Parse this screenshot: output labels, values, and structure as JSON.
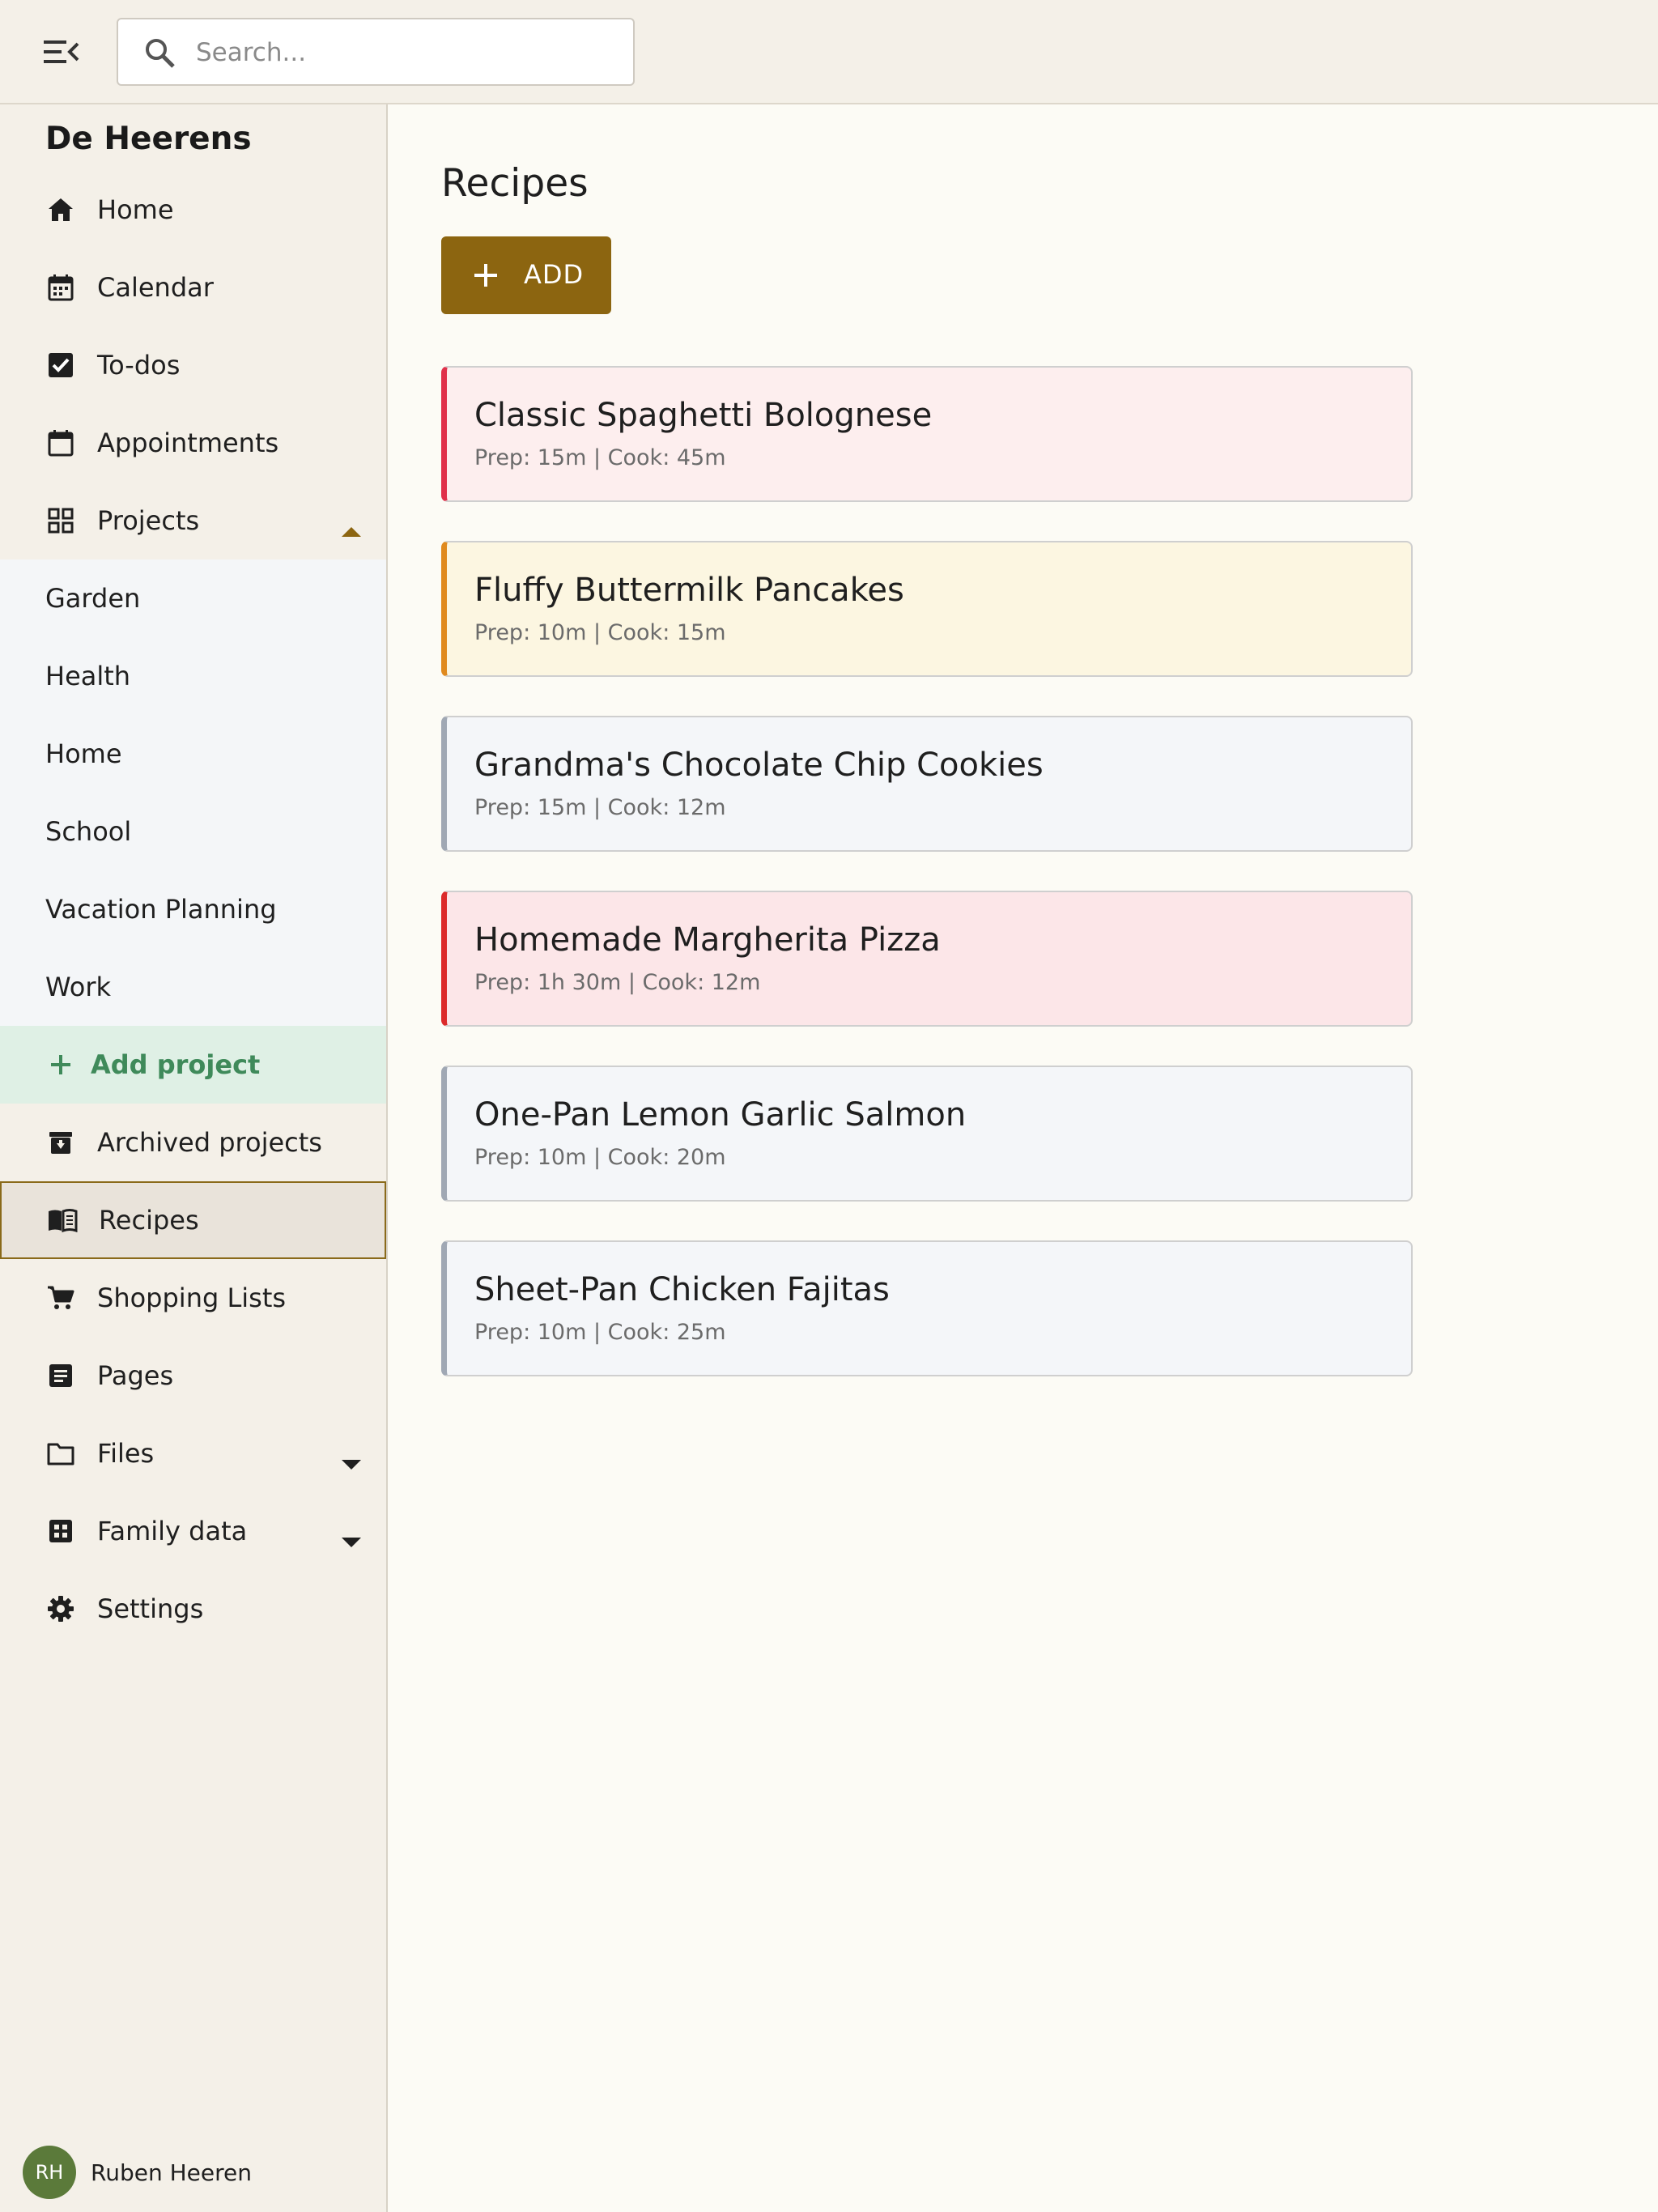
{
  "header": {
    "search_placeholder": "Search..."
  },
  "sidebar": {
    "brand": "De Heerens",
    "nav": {
      "home": "Home",
      "calendar": "Calendar",
      "todos": "To-dos",
      "appointments": "Appointments",
      "projects": "Projects",
      "add_project": "Add project",
      "archived_projects": "Archived projects",
      "recipes": "Recipes",
      "shopping_lists": "Shopping Lists",
      "pages": "Pages",
      "files": "Files",
      "family_data": "Family data",
      "settings": "Settings"
    },
    "projects": [
      "Garden",
      "Health",
      "Home",
      "School",
      "Vacation Planning",
      "Work"
    ],
    "user": {
      "initials": "RH",
      "name": "Ruben Heeren"
    }
  },
  "main": {
    "title": "Recipes",
    "add_label": "ADD",
    "recipes": [
      {
        "title": "Classic Spaghetti Bolognese",
        "meta": "Prep: 15m | Cook: 45m",
        "bg": "#fdeeee",
        "accent": "#e0304a"
      },
      {
        "title": "Fluffy Buttermilk Pancakes",
        "meta": "Prep: 10m | Cook: 15m",
        "bg": "#fcf6e1",
        "accent": "#e08a1e"
      },
      {
        "title": "Grandma's Chocolate Chip Cookies",
        "meta": "Prep: 15m | Cook: 12m",
        "bg": "#f4f6f9",
        "accent": "#a0a8b4"
      },
      {
        "title": "Homemade Margherita Pizza",
        "meta": "Prep: 1h 30m | Cook: 12m",
        "bg": "#fce6e8",
        "accent": "#dc2a2a"
      },
      {
        "title": "One-Pan Lemon Garlic Salmon",
        "meta": "Prep: 10m | Cook: 20m",
        "bg": "#f4f6f9",
        "accent": "#a0a8b4"
      },
      {
        "title": "Sheet-Pan Chicken Fajitas",
        "meta": "Prep: 10m | Cook: 25m",
        "bg": "#f4f6f9",
        "accent": "#a0a8b4"
      }
    ]
  },
  "colors": {
    "accent": "#8c6510",
    "add_project_green": "#3f8a5a"
  }
}
